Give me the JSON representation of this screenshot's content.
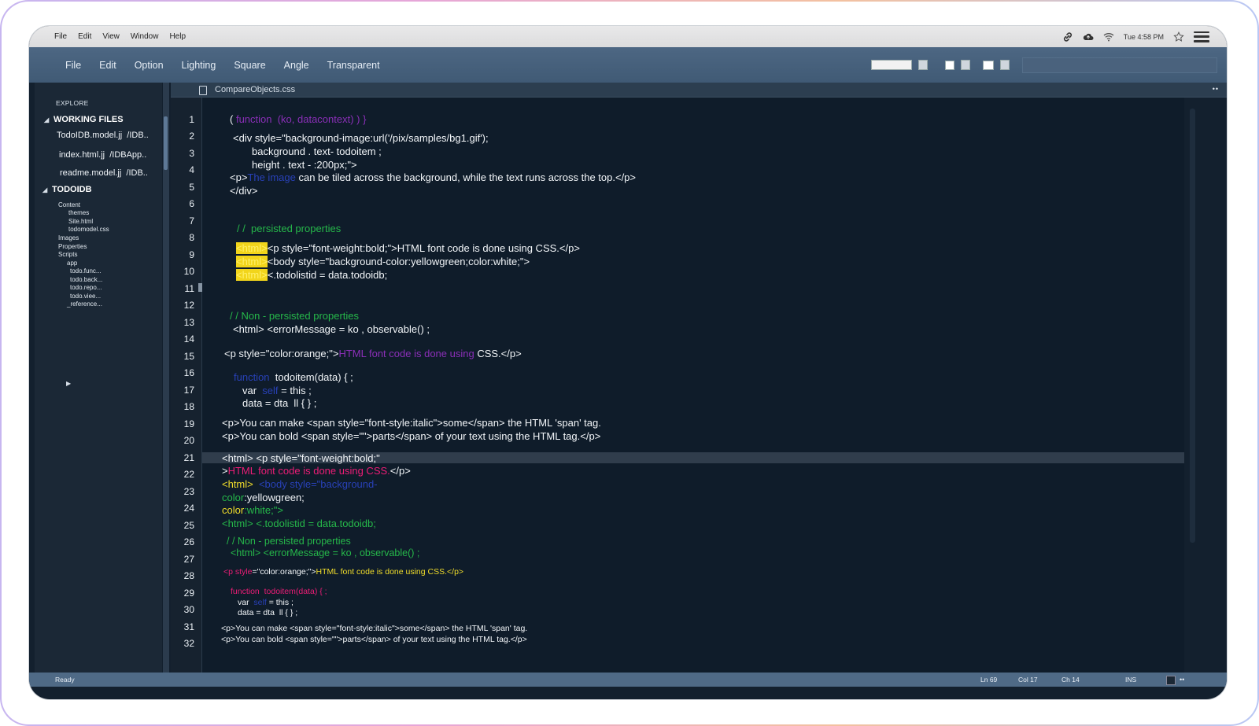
{
  "system_bar": {
    "menu": [
      "File",
      "Edit",
      "View",
      "Window",
      "Help"
    ],
    "clock": "Tue 4:58 PM",
    "icons": [
      "link-icon",
      "cloud-icon",
      "wifi-icon",
      "star-icon",
      "hamburger-menu-icon"
    ]
  },
  "app_menu": [
    "File",
    "Edit",
    "Option",
    "Lighting",
    "Square",
    "Angle",
    "Transparent"
  ],
  "sidebar": {
    "explore_label": "EXPLORE",
    "working_files_label": "WORKING FILES",
    "working_files": [
      {
        "name": "TodoIDB.model.jj",
        "path": "/IDB.."
      },
      {
        "name": "index.html.jj",
        "path": "/IDBApp.."
      },
      {
        "name": "readme.model.jj",
        "path": "/IDB.."
      }
    ],
    "project_label": "TODOIDB",
    "tree": [
      {
        "label": "Content",
        "depth": 0
      },
      {
        "label": "themes",
        "depth": 1
      },
      {
        "label": "Site.html",
        "depth": 1
      },
      {
        "label": "todomodel.css",
        "depth": 1
      },
      {
        "label": "Images",
        "depth": 0
      },
      {
        "label": "Properties",
        "depth": 0
      },
      {
        "label": "Scripts",
        "depth": 0
      },
      {
        "label": "app",
        "depth": 1
      },
      {
        "label": "todo.func...",
        "depth": 2
      },
      {
        "label": "todo.back...",
        "depth": 2
      },
      {
        "label": "todo.repo...",
        "depth": 2
      },
      {
        "label": "todo.viee...",
        "depth": 2
      },
      {
        "label": "_reference...",
        "depth": 2
      }
    ]
  },
  "editor": {
    "tab_label": "CompareObjects.css",
    "tab_dots": "••",
    "line_numbers": [
      "1",
      "2",
      "3",
      "4",
      "5",
      "6",
      "7",
      "8",
      "9",
      "10",
      "11",
      "12",
      "13",
      "14",
      "15",
      "16",
      "17",
      "18",
      "19",
      "20",
      "21",
      "22",
      "23",
      "24",
      "25",
      "26",
      "27",
      "28",
      "29",
      "30",
      "31",
      "32"
    ],
    "code": {
      "l1": [
        "( ",
        "function  (ko, datacontext) ) }"
      ],
      "l2": "<div style=\"background-image:url('/pix/samples/bg1.gif');",
      "l3": "background . text- todoitem ;",
      "l4": "height . text - :200px;\">",
      "l5": [
        "<p>",
        "The image ",
        "can be tiled across the background, while the text runs across the top.</p>"
      ],
      "l6": "</div>",
      "l7": "/ /  persisted properties",
      "l8": [
        "<html>",
        "<p style=\"font-weight:bold;\">HTML font code is done using CSS.</p>"
      ],
      "l9": [
        "<html>",
        "<body style=\"background-color:yellowgreen;color:white;\">"
      ],
      "l10": [
        "<html>",
        "<.todolistid = data.todoidb;"
      ],
      "l11": "/ / Non - persisted properties",
      "l12": "<html> <errorMessage = ko , observable() ;",
      "l13": [
        "<p style=\"color:orange;\">",
        "HTML font code is done using ",
        "CSS.</p>"
      ],
      "l14": [
        "function  ",
        "todoitem(data) { ;"
      ],
      "l15": [
        "var  ",
        "self ",
        "= this ;"
      ],
      "l16": "data = dta  ll { } ;",
      "l17": "<p>You can make <span style=\"font-style:italic\">some</span> the HTML 'span' tag.",
      "l18": "<p>You can bold <span style=\"\">parts</span> of your text using the HTML tag.</p>",
      "l19": "<html> <p style=\"font-weight:bold;\"",
      "l20": [
        ">",
        "HTML font code is done using CSS.",
        "</p>"
      ],
      "l21": [
        "<html>  ",
        "<body style=\"background-"
      ],
      "l22": [
        "color",
        ":yellowgreen;"
      ],
      "l23": [
        "color",
        ":white;\">"
      ],
      "l24": "<html> <.todolistid = data.todoidb;",
      "l25": "/ / Non - persisted properties",
      "l26": "<html> <errorMessage = ko , observable() ;",
      "l27": [
        "<p style",
        "=\"color:orange;\">",
        "HTML font code is done using CSS.</p>"
      ],
      "l28": "function  todoitem(data) { ;",
      "l29": [
        "var  ",
        "self ",
        "= this ;"
      ],
      "l30": "data = dta  ll { } ;",
      "l31": "<p>You can make <span style=\"font-style:italic\">some</span> the HTML 'span' tag.",
      "l32": "<p>You can bold <span style=\"\">parts</span> of your text using the HTML tag.</p>"
    }
  },
  "status_bar": {
    "state": "Ready",
    "line": "Ln 69",
    "col": "Col 17",
    "ch": "Ch 14",
    "mode": "INS",
    "dots": "••"
  },
  "colors": {
    "editor_bg": "#0f1c2a",
    "toolbar_bg": "#4d6783",
    "keyword_purple": "#8b2fb8",
    "comment_green": "#26b84a",
    "highlight_yellow": "#f2d51b",
    "string_pink": "#ec1d76"
  }
}
